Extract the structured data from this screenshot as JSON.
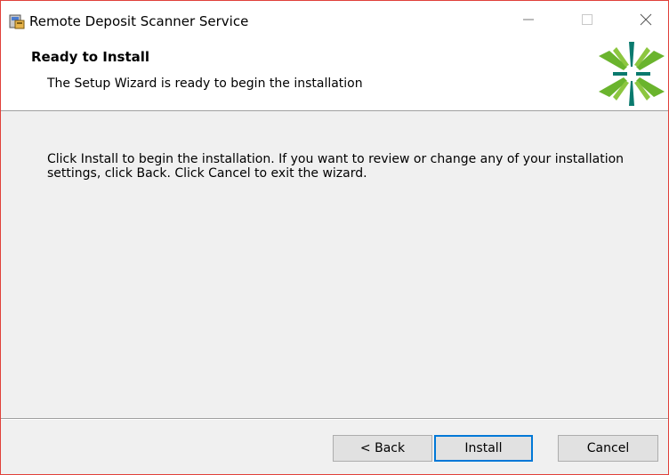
{
  "window": {
    "title": "Remote Deposit Scanner Service",
    "minimize_icon": "minimize-icon",
    "maximize_icon": "maximize-icon",
    "close_icon": "close-icon"
  },
  "header": {
    "title": "Ready to Install",
    "subtitle": "The Setup Wizard is ready to begin the installation",
    "logo_colors": [
      "#6ab42d",
      "#0a7a6e"
    ]
  },
  "body": {
    "message": "Click Install to begin the installation. If you want to review or change any of your installation settings, click Back. Click Cancel to exit the wizard."
  },
  "buttons": {
    "back": "< Back",
    "install": "Install",
    "cancel": "Cancel"
  },
  "colors": {
    "focus_border": "#0078d7",
    "window_border": "#e0403a"
  }
}
